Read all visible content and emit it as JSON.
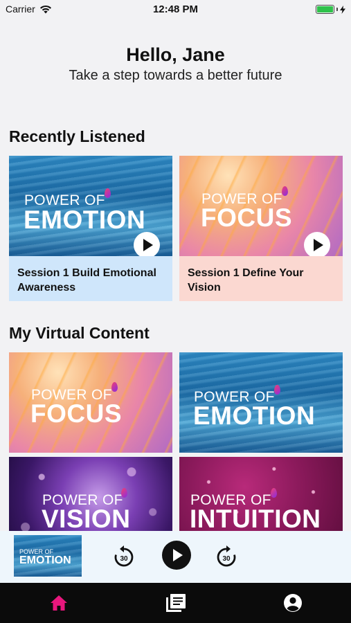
{
  "status_bar": {
    "carrier": "Carrier",
    "time": "12:48 PM"
  },
  "header": {
    "greeting": "Hello, Jane",
    "subtitle": "Take a step towards a better future"
  },
  "recently_listened": {
    "title": "Recently Listened",
    "items": [
      {
        "art_line1": "POWER OF",
        "art_line2": "EMOTION",
        "caption": "Session 1 Build Emotional Awareness",
        "theme": "emotion"
      },
      {
        "art_line1": "POWER OF",
        "art_line2": "FOCUS",
        "caption": "Session 1 Define Your Vision",
        "theme": "focus"
      }
    ]
  },
  "virtual_content": {
    "title": "My Virtual Content",
    "items": [
      {
        "art_line1": "POWER OF",
        "art_line2": "FOCUS",
        "theme": "focus"
      },
      {
        "art_line1": "POWER OF",
        "art_line2": "EMOTION",
        "theme": "emotion"
      },
      {
        "art_line1": "POWER OF",
        "art_line2": "VISION",
        "theme": "vision"
      },
      {
        "art_line1": "POWER OF",
        "art_line2": "INTUITION",
        "theme": "intuition"
      }
    ]
  },
  "mini_player": {
    "thumb_line1": "POWER OF",
    "thumb_line2": "EMOTION",
    "skip_back_label": "30",
    "skip_forward_label": "30"
  },
  "tab_bar": {
    "items": [
      {
        "icon": "home-icon",
        "active": true
      },
      {
        "icon": "library-icon",
        "active": false
      },
      {
        "icon": "profile-icon",
        "active": false
      }
    ],
    "active_color": "#e8177d",
    "inactive_color": "#ffffff"
  },
  "colors": {
    "emotion_caption_bg": "#cfe6fb",
    "focus_caption_bg": "#fbd8d1",
    "tab_bar_bg": "#0b0b0b"
  }
}
